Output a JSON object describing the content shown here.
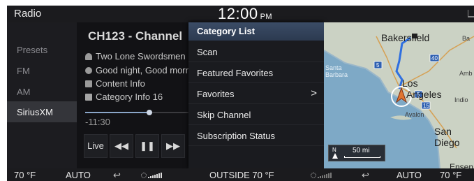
{
  "header": {
    "title": "Radio",
    "time": "12:00",
    "ampm": "PM"
  },
  "sources": [
    {
      "label": "Presets",
      "active": false
    },
    {
      "label": "FM",
      "active": false
    },
    {
      "label": "AM",
      "active": false
    },
    {
      "label": "SiriusXM",
      "active": true
    }
  ],
  "now_playing": {
    "channel": "CH123 - Channel",
    "artist": "Two Lone Swordsmen",
    "song": "Good night, Good morning",
    "content": "Content Info",
    "category": "Category Info 16",
    "time": "-11:30",
    "progress": 0.62,
    "controls": {
      "live": "Live"
    }
  },
  "category_menu": {
    "header": "Category List",
    "items": [
      {
        "label": "Scan"
      },
      {
        "label": "Featured Favorites"
      },
      {
        "label": "Favorites",
        "chevron": ">"
      },
      {
        "label": "Skip Channel"
      },
      {
        "label": "Subscription Status"
      }
    ]
  },
  "map": {
    "labels": {
      "bakersfield": "Bakersfield",
      "ba": "Ba",
      "santa_barbara": "Santa\nBarbara",
      "los": "Los",
      "angeles": "Angeles",
      "indio": "Indio",
      "avalon": "Avalon",
      "san_diego": "San\nDiego",
      "amb": "Amb",
      "ensen": "Ensen",
      "i5a": "5",
      "i40": "40",
      "i5b": "5",
      "i15": "15"
    },
    "scale": {
      "north": "N",
      "distance": "50 mi"
    },
    "colors": {
      "land": "#cbd2c4",
      "water": "#7ea9c6",
      "route": "#2f6fe0"
    }
  },
  "climate": {
    "left_temp": "70 °F",
    "left_mode": "AUTO",
    "outside": "OUTSIDE  70 °F",
    "right_mode": "AUTO",
    "right_temp": "70 °F"
  }
}
